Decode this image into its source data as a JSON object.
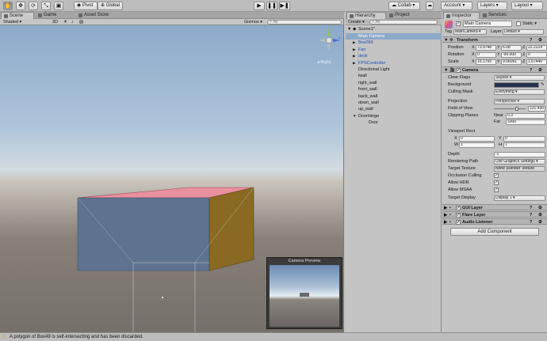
{
  "toolbar": {
    "tools": [
      "hand-tool-icon",
      "move-tool-icon",
      "rotate-tool-icon",
      "scale-tool-icon",
      "rect-tool-icon"
    ],
    "pivot": "Pivot",
    "global": "Global",
    "collab": "Collab",
    "account": "Account",
    "layers": "Layers",
    "layout": "Layout"
  },
  "tabs": {
    "scene": "Scene",
    "game": "Game",
    "asset_store": "Asset Store",
    "hierarchy": "Hierarchy",
    "project": "Project",
    "inspector": "Inspector",
    "services": "Services"
  },
  "scene_bar": {
    "shading": "Shaded",
    "mode": "2D",
    "gizmos": "Gizmos",
    "search": "All"
  },
  "scene": {
    "gizmo_label": "Right",
    "preview_title": "Camera Preview",
    "colors": {
      "top": "#e8909e",
      "front": "#5d7390",
      "side": "#8a6a22"
    }
  },
  "hierarchy": {
    "create": "Create",
    "search": "All",
    "scene": "Scene1*",
    "items": [
      {
        "label": "Main Camera",
        "selected": true,
        "prefab": false,
        "arrow": ""
      },
      {
        "label": "Box099",
        "selected": false,
        "prefab": true,
        "arrow": "▶"
      },
      {
        "label": "Fan",
        "selected": false,
        "prefab": true,
        "arrow": "▶"
      },
      {
        "label": "desk",
        "selected": false,
        "prefab": true,
        "arrow": "▶"
      },
      {
        "label": "FPSController",
        "selected": false,
        "prefab": true,
        "arrow": "▶"
      },
      {
        "label": "Directional Light",
        "selected": false,
        "prefab": false,
        "arrow": ""
      },
      {
        "label": "lwall",
        "selected": false,
        "prefab": false,
        "arrow": ""
      },
      {
        "label": "right_wall",
        "selected": false,
        "prefab": false,
        "arrow": ""
      },
      {
        "label": "front_wall",
        "selected": false,
        "prefab": false,
        "arrow": ""
      },
      {
        "label": "back_wall",
        "selected": false,
        "prefab": false,
        "arrow": ""
      },
      {
        "label": "down_wall",
        "selected": false,
        "prefab": false,
        "arrow": ""
      },
      {
        "label": "up_wall",
        "selected": false,
        "prefab": false,
        "arrow": ""
      },
      {
        "label": "DoorHinge",
        "selected": false,
        "prefab": false,
        "arrow": "▼"
      },
      {
        "label": "Door",
        "selected": false,
        "prefab": false,
        "arrow": "",
        "child": true
      }
    ]
  },
  "inspector": {
    "name": "Main Camera",
    "static": "Static",
    "tag_label": "Tag",
    "tag": "MainCamera",
    "layer_label": "Layer",
    "layer": "Default",
    "transform": {
      "title": "Transform",
      "position_label": "Position",
      "position": [
        "73.9748",
        "6.08",
        "22.2214"
      ],
      "rotation_label": "Rotation",
      "rotation": [
        "0",
        "-90.000",
        "0"
      ],
      "scale_label": "Scale",
      "scale": [
        "16.1755",
        "9.06091",
        "1.67440"
      ],
      "axes": [
        "X",
        "Y",
        "Z"
      ]
    },
    "camera": {
      "title": "Camera",
      "clear_flags_label": "Clear Flags",
      "clear_flags": "Skybox",
      "background_label": "Background",
      "background_color": "#22324f",
      "culling_label": "Culling Mask",
      "culling": "Everything",
      "projection_label": "Projection",
      "projection": "Perspective",
      "fov_label": "Field of View",
      "fov": "131.430",
      "fov_fraction": 0.73,
      "clipping_label": "Clipping Planes",
      "near_label": "Near",
      "near": "0.3",
      "far_label": "Far",
      "far": "1000",
      "viewport_label": "Viewport Rect",
      "vp_x_label": "X",
      "vp_x": "0",
      "vp_y_label": "Y",
      "vp_y": "0",
      "vp_w_label": "W",
      "vp_w": "1",
      "vp_h_label": "H",
      "vp_h": "1",
      "depth_label": "Depth",
      "depth": "-1",
      "rendering_label": "Rendering Path",
      "rendering": "Use Graphics Settings",
      "target_texture_label": "Target Texture",
      "target_texture": "None (Render Texture",
      "occlusion_label": "Occlusion Culling",
      "hdr_label": "Allow HDR",
      "msaa_label": "Allow MSAA",
      "display_label": "Target Display",
      "display": "Display 1"
    },
    "components": [
      "GUI Layer",
      "Flare Layer",
      "Audio Listener"
    ],
    "add_component": "Add Component"
  },
  "status": {
    "message": "A polygon of Box49 is self-intersecting and has been discarded."
  }
}
